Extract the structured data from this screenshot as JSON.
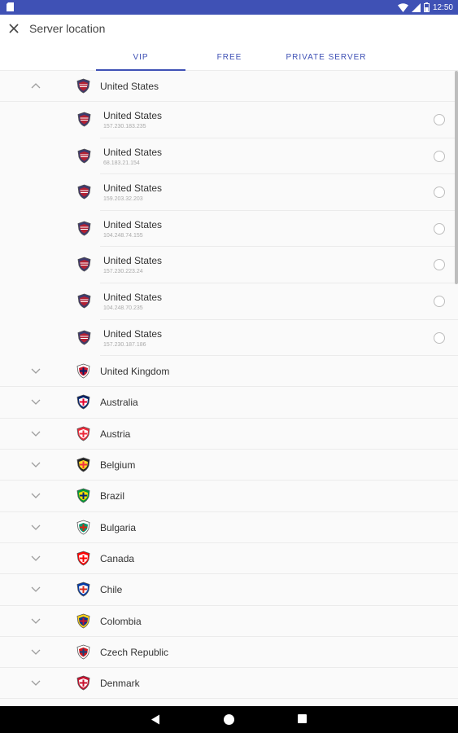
{
  "status_bar": {
    "time": "12:50",
    "icons": [
      "sim-card-icon",
      "wifi-icon",
      "signal-icon",
      "battery-icon"
    ],
    "color": "#3f51b5"
  },
  "header": {
    "title": "Server location",
    "close_icon": "close-icon"
  },
  "tabs": [
    {
      "label": "VIP",
      "active": true
    },
    {
      "label": "FREE",
      "active": false
    },
    {
      "label": "PRIVATE SERVER",
      "active": false
    }
  ],
  "accent_color": "#3f51b5",
  "expanded_country": {
    "name": "United States",
    "servers": [
      {
        "name": "United States",
        "ip": "157.230.183.235"
      },
      {
        "name": "United States",
        "ip": "68.183.21.154"
      },
      {
        "name": "United States",
        "ip": "159.203.32.203"
      },
      {
        "name": "United States",
        "ip": "104.248.74.155"
      },
      {
        "name": "United States",
        "ip": "157.230.223.24"
      },
      {
        "name": "United States",
        "ip": "104.248.70.235"
      },
      {
        "name": "United States",
        "ip": "157.230.187.186"
      }
    ]
  },
  "countries": [
    {
      "name": "United Kingdom",
      "flag_colors": [
        "#ffffff",
        "#cf142b",
        "#012169"
      ]
    },
    {
      "name": "Australia",
      "flag_colors": [
        "#012169",
        "#ffffff",
        "#e4002b"
      ]
    },
    {
      "name": "Austria",
      "flag_colors": [
        "#ed2939",
        "#ffffff",
        "#ed2939"
      ]
    },
    {
      "name": "Belgium",
      "flag_colors": [
        "#222222",
        "#fdda24",
        "#ef3340"
      ]
    },
    {
      "name": "Brazil",
      "flag_colors": [
        "#009c3b",
        "#ffdf00",
        "#002776"
      ]
    },
    {
      "name": "Bulgaria",
      "flag_colors": [
        "#ffffff",
        "#00966e",
        "#d62612"
      ]
    },
    {
      "name": "Canada",
      "flag_colors": [
        "#ff0000",
        "#ffffff",
        "#ff0000"
      ]
    },
    {
      "name": "Chile",
      "flag_colors": [
        "#0039a6",
        "#ffffff",
        "#d52b1e"
      ]
    },
    {
      "name": "Colombia",
      "flag_colors": [
        "#fcd116",
        "#003893",
        "#ce1126"
      ]
    },
    {
      "name": "Czech Republic",
      "flag_colors": [
        "#ffffff",
        "#d7141a",
        "#11457e"
      ]
    },
    {
      "name": "Denmark",
      "flag_colors": [
        "#c8102e",
        "#ffffff",
        "#c8102e"
      ]
    }
  ],
  "nav_bar": {
    "buttons": [
      "back-icon",
      "home-icon",
      "recents-icon"
    ]
  }
}
